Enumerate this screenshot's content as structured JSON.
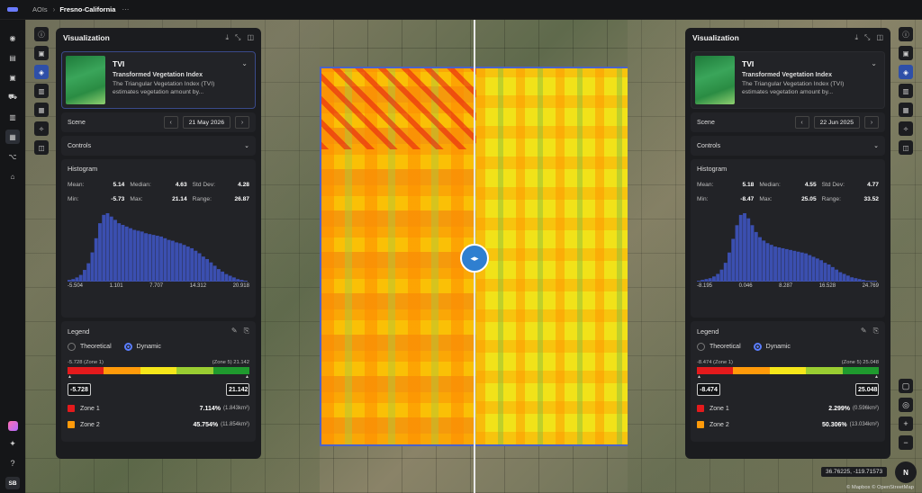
{
  "breadcrumb": {
    "root": "AOIs",
    "current": "Fresno-California",
    "more": "···"
  },
  "left_rail": {
    "user_initials": "SB"
  },
  "split_handle": {
    "icon": "◂▸"
  },
  "panels": [
    {
      "title": "Visualization",
      "index": {
        "title": "TVI",
        "subtitle": "Transformed Vegetation Index",
        "description": "The Triangular Vegetation Index (TVI) estimates vegetation amount by..."
      },
      "scene_label": "Scene",
      "scene_date": "21 May 2026",
      "controls_label": "Controls",
      "histogram_label": "Histogram",
      "stats": {
        "mean_label": "Mean:",
        "mean": "5.14",
        "median_label": "Median:",
        "median": "4.63",
        "std_label": "Std Dev:",
        "std": "4.28",
        "min_label": "Min:",
        "min": "-5.73",
        "max_label": "Max:",
        "max": "21.14",
        "range_label": "Range:",
        "range": "26.87"
      },
      "hist_ticks": [
        "-5.504",
        "1.101",
        "7.707",
        "14.312",
        "20.918"
      ],
      "hist_values": [
        2,
        3,
        5,
        8,
        14,
        22,
        35,
        52,
        70,
        80,
        82,
        78,
        74,
        70,
        68,
        66,
        64,
        62,
        61,
        60,
        58,
        57,
        56,
        55,
        54,
        52,
        50,
        49,
        47,
        46,
        44,
        42,
        40,
        37,
        34,
        30,
        27,
        23,
        19,
        15,
        12,
        9,
        7,
        5,
        3,
        2,
        1
      ],
      "legend_label": "Legend",
      "mode_theoretical": "Theoretical",
      "mode_dynamic": "Dynamic",
      "zone_low_label": "-5.728 (Zone 1)",
      "zone_high_label": "(Zone 5) 21.142",
      "input_min": "-5.728",
      "input_max": "21.142",
      "zones": [
        {
          "name": "Zone 1",
          "pct": "7.114%",
          "area": "(1.843km²)",
          "color": "#e41a1c"
        },
        {
          "name": "Zone 2",
          "pct": "45.754%",
          "area": "(11.854km²)",
          "color": "#ff9a0a"
        }
      ]
    },
    {
      "title": "Visualization",
      "index": {
        "title": "TVI",
        "subtitle": "Transformed Vegetation Index",
        "description": "The Triangular Vegetation Index (TVI) estimates vegetation amount by..."
      },
      "scene_label": "Scene",
      "scene_date": "22 Jun 2025",
      "controls_label": "Controls",
      "histogram_label": "Histogram",
      "stats": {
        "mean_label": "Mean:",
        "mean": "5.18",
        "median_label": "Median:",
        "median": "4.55",
        "std_label": "Std Dev:",
        "std": "4.77",
        "min_label": "Min:",
        "min": "-8.47",
        "max_label": "Max:",
        "max": "25.05",
        "range_label": "Range:",
        "range": "33.52"
      },
      "hist_ticks": [
        "-8.195",
        "0.046",
        "8.287",
        "16.528",
        "24.769"
      ],
      "hist_values": [
        1,
        2,
        3,
        4,
        6,
        9,
        14,
        22,
        34,
        50,
        66,
        78,
        80,
        74,
        66,
        58,
        52,
        48,
        45,
        43,
        41,
        40,
        39,
        38,
        37,
        36,
        35,
        34,
        33,
        31,
        29,
        27,
        25,
        22,
        20,
        17,
        14,
        11,
        9,
        7,
        5,
        4,
        3,
        2,
        1,
        1,
        1
      ],
      "legend_label": "Legend",
      "mode_theoretical": "Theoretical",
      "mode_dynamic": "Dynamic",
      "zone_low_label": "-8.474 (Zone 1)",
      "zone_high_label": "(Zone 5) 25.048",
      "input_min": "-8.474",
      "input_max": "25.048",
      "zones": [
        {
          "name": "Zone 1",
          "pct": "2.299%",
          "area": "(0.596km²)",
          "color": "#e41a1c"
        },
        {
          "name": "Zone 2",
          "pct": "50.306%",
          "area": "(13.034km²)",
          "color": "#ff9a0a"
        }
      ]
    }
  ],
  "ramp_colors": [
    "#e41a1c",
    "#ff9a0a",
    "#f5e61a",
    "#9acd32",
    "#1f9a2e"
  ],
  "map": {
    "coordinates": "36.76225, -119.71573",
    "attribution": "© Mapbox © OpenStreetMap",
    "compass": "N"
  }
}
